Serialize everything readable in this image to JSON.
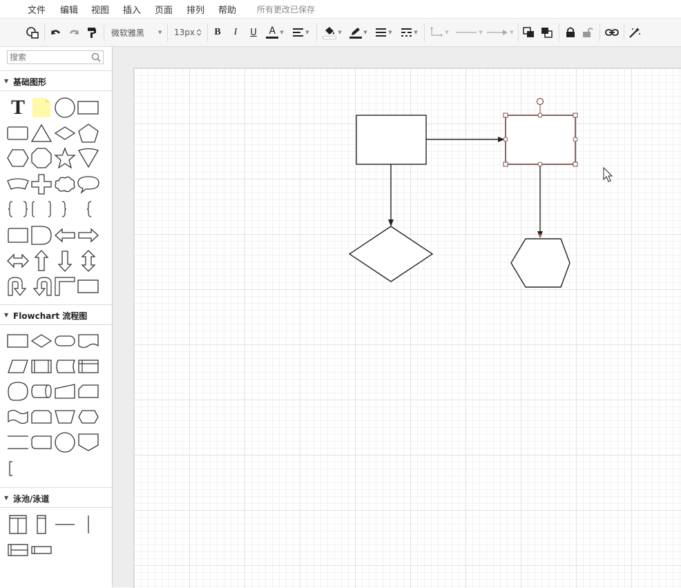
{
  "menu": {
    "items": [
      "文件",
      "编辑",
      "视图",
      "插入",
      "页面",
      "排列",
      "帮助"
    ],
    "status": "所有更改已保存"
  },
  "toolbar": {
    "font_name": "微软雅黑",
    "font_size": "13px",
    "bold": "B",
    "italic": "I",
    "underline": "U",
    "font_color": "A"
  },
  "sidebar": {
    "search_placeholder": "搜索",
    "sections": [
      {
        "label": "基础图形",
        "expanded": true
      },
      {
        "label": "Flowchart 流程图",
        "expanded": true
      },
      {
        "label": "泳池/泳道",
        "expanded": true
      }
    ],
    "basic_text_shape": "T"
  },
  "colors": {
    "accent": "#7b4747",
    "note_fill": "#fff9a8",
    "shape_stroke": "#333333",
    "canvas_bg": "#ededed"
  }
}
